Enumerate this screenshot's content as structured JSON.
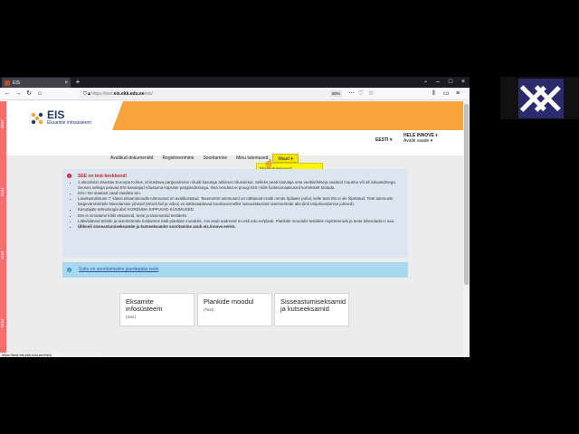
{
  "browser": {
    "tab_title": "EIS",
    "new_tab": "+",
    "url_prefix": "https://test.",
    "url_domain": "eis.ekk.edu.ee",
    "url_path": "/eis/",
    "zoom": "80%",
    "status_url": "https://test.eis.ekk.edu.ee/eis/#"
  },
  "colors": {
    "header_accent": "#f7a33b",
    "test_stripe": "#f46e6e",
    "menu_active": "#f3e400",
    "notice_bg": "#dde6f0",
    "info_bg": "#a8d8f0"
  },
  "test_stripe_labels": [
    "TEST",
    "TEST",
    "TEST",
    "TEST",
    "TEST"
  ],
  "logo": {
    "title": "EIS",
    "subtitle": "Eksamite infosüsteem"
  },
  "header": {
    "language": "EESTI",
    "user_name": "HELE INNOVE",
    "user_sub": "Avalik vaade"
  },
  "menu": {
    "items": [
      "Avalikud dokumendid",
      "Registreerimine",
      "Sooritamine",
      "Minu tulemused",
      "Muud"
    ],
    "dropdown": [
      "Eksamitulemused",
      "Testide tulemuste statistika"
    ]
  },
  "notice": {
    "title": "SEE on test-keskkond!",
    "items": [
      "1.oktoobrist otsustas Euroopa Kohus, et küsitava pargiandmine nõuab kasutaja aktiivset nõusolekut. Selleks peab kasutaja oma veebilehitseja seadeid muutma või all isikuandmega. Seoses sellega peavad EIS kasutajad nõustuma küpsiste pargiandmisega. Ilma nendeta ei pruugi EIS-i kõik funktsionaalsused korrektselt töötada.",
      "EIS-i töö staatust saad vaadata siin.",
      "Lasekustulistuse 7. klassi eksamimoodle tulemused on avalikustatud. Tasemetöö tulemused on nähtavad eraldi nende õpilaste puhul, kelle testi töö ei ole lõpetatud. Testi tulemuste lasgevärmislstele täiendamise juhised (Wordi fail ja video) on kättesaadavad koolisuvernellist lustuvastamiste tasemetööde alla (link tööjuhendamise juhised).",
      "Kasutajate tehnoloogia abil: KORDUMA KIPPUVAD KÜSIMUSED.",
      "EIS-is nimetame kõiki eksameid, teste ja tasemetöid testideks.",
      "Läbiviidavad testide ja tasemetööde koldamine käib plankide moodulis, mis asub aadressil rm.ekk.edu.ee/plank. Plankide moodulis testidele registreeruda ja teste lahendada ei saa.",
      "Ülikooli sisseastumiseksamite ja kutseeksamite sooritamine asub eis.innove.ee/eis."
    ]
  },
  "info": {
    "link_text": "Suitu on sooritamiseks juurdepääs tests"
  },
  "cards": [
    {
      "title": "Eksamite infosüsteem",
      "sub": "(See)"
    },
    {
      "title": "Plankide moodul",
      "sub": "(Test)"
    },
    {
      "title": "Sisseastumiseksamid ja kutseeksamid",
      "sub": ""
    }
  ]
}
